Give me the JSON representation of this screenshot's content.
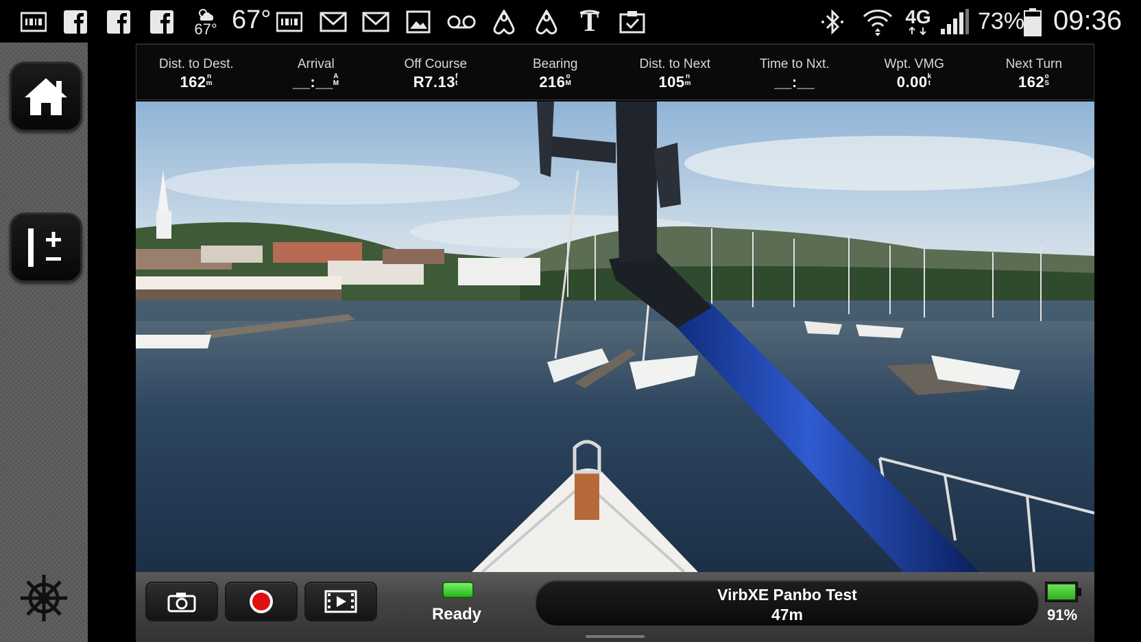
{
  "status_bar": {
    "weather_temp_small": "67°",
    "weather_temp": "67°",
    "battery_percent": "73%",
    "time": "09:36",
    "network": "4G",
    "left_icons": [
      "barcode-icon",
      "facebook-icon",
      "facebook-icon",
      "facebook-icon",
      "weather-icon",
      "barcode-icon",
      "gmail-icon",
      "gmail-icon",
      "gallery-icon",
      "voicemail-icon",
      "airbnb-icon",
      "airbnb-icon",
      "nytimes-icon",
      "clipboard-icon"
    ],
    "right_icons": [
      "bluetooth-icon",
      "wifi-icon",
      "lte-icon",
      "signal-icon",
      "battery-icon"
    ]
  },
  "sidebar": {
    "buttons": [
      "home-icon",
      "data-config-icon",
      "helm-icon"
    ]
  },
  "data_bar": {
    "fields": [
      {
        "label": "Dist. to Dest.",
        "value": "162",
        "unit_top": "n",
        "unit_bottom": "m"
      },
      {
        "label": "Arrival",
        "value": "__:__",
        "unit_top": "A",
        "unit_bottom": "M"
      },
      {
        "label": "Off Course",
        "value": "R7.13",
        "unit_top": "f",
        "unit_bottom": "t"
      },
      {
        "label": "Bearing",
        "value": "216",
        "unit_top": "o",
        "unit_bottom": "M"
      },
      {
        "label": "Dist. to Next",
        "value": "105",
        "unit_top": "n",
        "unit_bottom": "m"
      },
      {
        "label": "Time to Nxt.",
        "value": "__:__",
        "unit_top": "",
        "unit_bottom": ""
      },
      {
        "label": "Wpt. VMG",
        "value": "0.00",
        "unit_top": "k",
        "unit_bottom": "t"
      },
      {
        "label": "Next Turn",
        "value": "162",
        "unit_top": "o",
        "unit_bottom": "S"
      }
    ]
  },
  "controls": {
    "buttons": [
      "camera-icon",
      "record-icon",
      "playback-icon"
    ],
    "status_label": "Ready",
    "status_color": "#2fc41f",
    "camera_name": "VirbXE Panbo Test",
    "camera_distance": "47m",
    "camera_battery_label": "91%",
    "camera_battery_level": 0.91,
    "record_color": "#e01010"
  }
}
